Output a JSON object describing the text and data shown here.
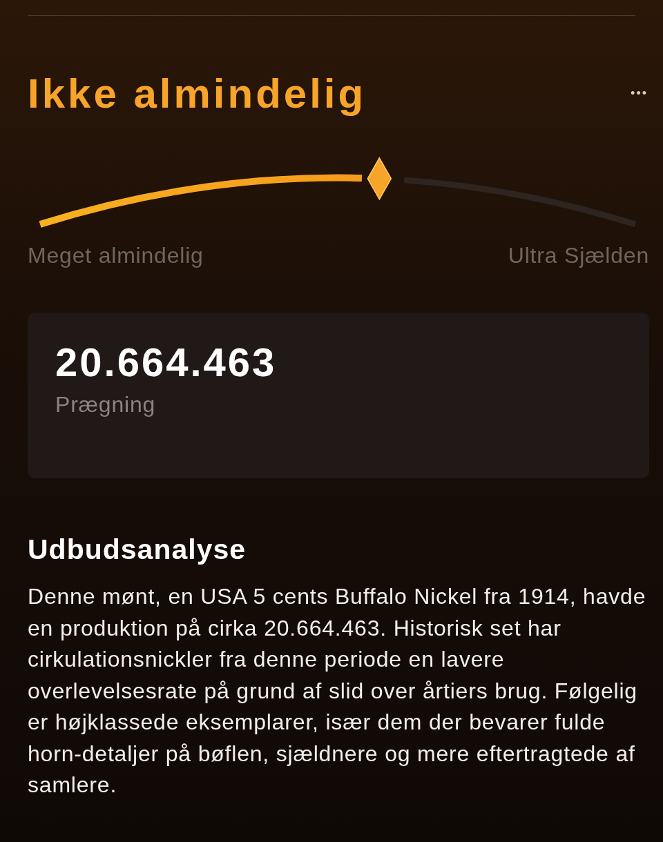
{
  "rarity": {
    "title": "Ikke almindelig",
    "menu": "•••",
    "min_label": "Meget almindelig",
    "max_label": "Ultra Sjælden"
  },
  "mintage": {
    "value": "20.664.463",
    "label": "Prægning"
  },
  "analysis": {
    "heading": "Udbudsanalyse",
    "text": "Denne mønt, en USA 5 cents Buffalo Nickel fra 1914, havde en produktion på cirka 20.664.463. Historisk set har cirkulationsnickler fra denne periode en lavere overlevelsesrate på grund af slid over årtiers brug. Følgelig er højklassede eksemplarer, især dem der bevarer fulde horn-detaljer på bøflen, sjældnere og mere eftertragtede af samlere."
  }
}
